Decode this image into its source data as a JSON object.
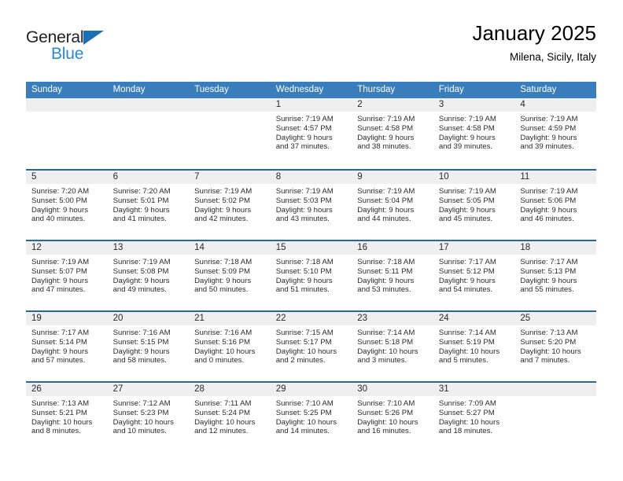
{
  "brand": {
    "name_top": "General",
    "name_bottom": "Blue",
    "triangle_color": "#1a6fb5",
    "top_color": "#231f20",
    "bottom_color": "#2b88d8"
  },
  "header": {
    "title": "January 2025",
    "subtitle": "Milena, Sicily, Italy",
    "accent_color": "#3a7dbd",
    "separator_color": "#2566a5"
  },
  "calendar": {
    "weekday_headers": [
      "Sunday",
      "Monday",
      "Tuesday",
      "Wednesday",
      "Thursday",
      "Friday",
      "Saturday"
    ],
    "weeks": [
      [
        {
          "day": "",
          "lines": []
        },
        {
          "day": "",
          "lines": []
        },
        {
          "day": "",
          "lines": []
        },
        {
          "day": "1",
          "lines": [
            "Sunrise: 7:19 AM",
            "Sunset: 4:57 PM",
            "Daylight: 9 hours",
            "and 37 minutes."
          ]
        },
        {
          "day": "2",
          "lines": [
            "Sunrise: 7:19 AM",
            "Sunset: 4:58 PM",
            "Daylight: 9 hours",
            "and 38 minutes."
          ]
        },
        {
          "day": "3",
          "lines": [
            "Sunrise: 7:19 AM",
            "Sunset: 4:58 PM",
            "Daylight: 9 hours",
            "and 39 minutes."
          ]
        },
        {
          "day": "4",
          "lines": [
            "Sunrise: 7:19 AM",
            "Sunset: 4:59 PM",
            "Daylight: 9 hours",
            "and 39 minutes."
          ]
        }
      ],
      [
        {
          "day": "5",
          "lines": [
            "Sunrise: 7:20 AM",
            "Sunset: 5:00 PM",
            "Daylight: 9 hours",
            "and 40 minutes."
          ]
        },
        {
          "day": "6",
          "lines": [
            "Sunrise: 7:20 AM",
            "Sunset: 5:01 PM",
            "Daylight: 9 hours",
            "and 41 minutes."
          ]
        },
        {
          "day": "7",
          "lines": [
            "Sunrise: 7:19 AM",
            "Sunset: 5:02 PM",
            "Daylight: 9 hours",
            "and 42 minutes."
          ]
        },
        {
          "day": "8",
          "lines": [
            "Sunrise: 7:19 AM",
            "Sunset: 5:03 PM",
            "Daylight: 9 hours",
            "and 43 minutes."
          ]
        },
        {
          "day": "9",
          "lines": [
            "Sunrise: 7:19 AM",
            "Sunset: 5:04 PM",
            "Daylight: 9 hours",
            "and 44 minutes."
          ]
        },
        {
          "day": "10",
          "lines": [
            "Sunrise: 7:19 AM",
            "Sunset: 5:05 PM",
            "Daylight: 9 hours",
            "and 45 minutes."
          ]
        },
        {
          "day": "11",
          "lines": [
            "Sunrise: 7:19 AM",
            "Sunset: 5:06 PM",
            "Daylight: 9 hours",
            "and 46 minutes."
          ]
        }
      ],
      [
        {
          "day": "12",
          "lines": [
            "Sunrise: 7:19 AM",
            "Sunset: 5:07 PM",
            "Daylight: 9 hours",
            "and 47 minutes."
          ]
        },
        {
          "day": "13",
          "lines": [
            "Sunrise: 7:19 AM",
            "Sunset: 5:08 PM",
            "Daylight: 9 hours",
            "and 49 minutes."
          ]
        },
        {
          "day": "14",
          "lines": [
            "Sunrise: 7:18 AM",
            "Sunset: 5:09 PM",
            "Daylight: 9 hours",
            "and 50 minutes."
          ]
        },
        {
          "day": "15",
          "lines": [
            "Sunrise: 7:18 AM",
            "Sunset: 5:10 PM",
            "Daylight: 9 hours",
            "and 51 minutes."
          ]
        },
        {
          "day": "16",
          "lines": [
            "Sunrise: 7:18 AM",
            "Sunset: 5:11 PM",
            "Daylight: 9 hours",
            "and 53 minutes."
          ]
        },
        {
          "day": "17",
          "lines": [
            "Sunrise: 7:17 AM",
            "Sunset: 5:12 PM",
            "Daylight: 9 hours",
            "and 54 minutes."
          ]
        },
        {
          "day": "18",
          "lines": [
            "Sunrise: 7:17 AM",
            "Sunset: 5:13 PM",
            "Daylight: 9 hours",
            "and 55 minutes."
          ]
        }
      ],
      [
        {
          "day": "19",
          "lines": [
            "Sunrise: 7:17 AM",
            "Sunset: 5:14 PM",
            "Daylight: 9 hours",
            "and 57 minutes."
          ]
        },
        {
          "day": "20",
          "lines": [
            "Sunrise: 7:16 AM",
            "Sunset: 5:15 PM",
            "Daylight: 9 hours",
            "and 58 minutes."
          ]
        },
        {
          "day": "21",
          "lines": [
            "Sunrise: 7:16 AM",
            "Sunset: 5:16 PM",
            "Daylight: 10 hours",
            "and 0 minutes."
          ]
        },
        {
          "day": "22",
          "lines": [
            "Sunrise: 7:15 AM",
            "Sunset: 5:17 PM",
            "Daylight: 10 hours",
            "and 2 minutes."
          ]
        },
        {
          "day": "23",
          "lines": [
            "Sunrise: 7:14 AM",
            "Sunset: 5:18 PM",
            "Daylight: 10 hours",
            "and 3 minutes."
          ]
        },
        {
          "day": "24",
          "lines": [
            "Sunrise: 7:14 AM",
            "Sunset: 5:19 PM",
            "Daylight: 10 hours",
            "and 5 minutes."
          ]
        },
        {
          "day": "25",
          "lines": [
            "Sunrise: 7:13 AM",
            "Sunset: 5:20 PM",
            "Daylight: 10 hours",
            "and 7 minutes."
          ]
        }
      ],
      [
        {
          "day": "26",
          "lines": [
            "Sunrise: 7:13 AM",
            "Sunset: 5:21 PM",
            "Daylight: 10 hours",
            "and 8 minutes."
          ]
        },
        {
          "day": "27",
          "lines": [
            "Sunrise: 7:12 AM",
            "Sunset: 5:23 PM",
            "Daylight: 10 hours",
            "and 10 minutes."
          ]
        },
        {
          "day": "28",
          "lines": [
            "Sunrise: 7:11 AM",
            "Sunset: 5:24 PM",
            "Daylight: 10 hours",
            "and 12 minutes."
          ]
        },
        {
          "day": "29",
          "lines": [
            "Sunrise: 7:10 AM",
            "Sunset: 5:25 PM",
            "Daylight: 10 hours",
            "and 14 minutes."
          ]
        },
        {
          "day": "30",
          "lines": [
            "Sunrise: 7:10 AM",
            "Sunset: 5:26 PM",
            "Daylight: 10 hours",
            "and 16 minutes."
          ]
        },
        {
          "day": "31",
          "lines": [
            "Sunrise: 7:09 AM",
            "Sunset: 5:27 PM",
            "Daylight: 10 hours",
            "and 18 minutes."
          ]
        },
        {
          "day": "",
          "lines": []
        }
      ]
    ]
  }
}
